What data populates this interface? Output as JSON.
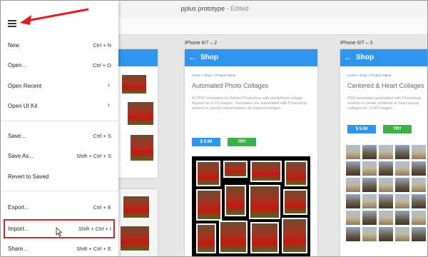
{
  "window": {
    "title": "pplus prototype",
    "edited": "Edited"
  },
  "menu": {
    "items": [
      {
        "label": "New",
        "shortcut": "Ctrl + N"
      },
      {
        "label": "Open...",
        "shortcut": "Ctrl + O"
      },
      {
        "label": "Open Recent",
        "shortcut": ""
      },
      {
        "label": "Open UI Kit",
        "shortcut": ""
      },
      {
        "label": "Save...",
        "shortcut": "Ctrl + S"
      },
      {
        "label": "Save As...",
        "shortcut": "Shift + Ctrl + S"
      },
      {
        "label": "Revert to Saved",
        "shortcut": ""
      },
      {
        "label": "Export...",
        "shortcut": "Ctrl + E"
      },
      {
        "label": "Import...",
        "shortcut": "Shift + Ctrl + I"
      },
      {
        "label": "Share...",
        "shortcut": "Shift + Ctrl + E"
      }
    ]
  },
  "artboards": [
    {
      "label": "iPhone 6/7 – 2",
      "appbar_title": "Shop",
      "breadcrumb": "Home > Shop > Product Name",
      "heading": "Automated Photo Collages",
      "description": "47 PSD templates for Adobe Photoshop with predefined collage layouts for 6-13 images. Templates are automated with Photoshop actions to quickly place/replace all required images.",
      "price": "$ 5.99",
      "try_label": "TRY"
    },
    {
      "label": "iPhone 6/7 – 3",
      "appbar_title": "Shop",
      "breadcrumb": "Home > Shop > Product Name",
      "heading": "Centered & Heart Collages",
      "description": "PSD templates automated with Photoshop actions to create centered or heart layout collages for 13-49 images.",
      "price": "$ 5.00",
      "try_label": "TRY"
    }
  ],
  "colors": {
    "accent": "#2f96ef",
    "try": "#3cb14a",
    "highlight": "#d0232a"
  }
}
